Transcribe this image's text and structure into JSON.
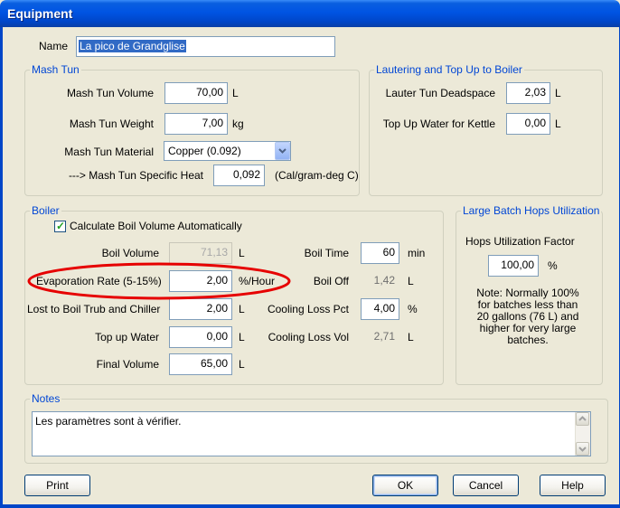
{
  "window": {
    "title": "Equipment",
    "close_label": "X"
  },
  "name": {
    "label": "Name",
    "value": "La pico de Grandglise"
  },
  "mash_tun": {
    "legend": "Mash Tun",
    "volume": {
      "label": "Mash Tun Volume",
      "value": "70,00",
      "unit": "L"
    },
    "weight": {
      "label": "Mash Tun Weight",
      "value": "7,00",
      "unit": "kg"
    },
    "material": {
      "label": "Mash Tun Material",
      "value": "Copper (0.092)"
    },
    "specific_heat": {
      "label": "---> Mash Tun Specific Heat",
      "value": "0,092",
      "unit": "(Cal/gram-deg C)"
    }
  },
  "lautering": {
    "legend": "Lautering and Top Up to Boiler",
    "deadspace": {
      "label": "Lauter Tun Deadspace",
      "value": "2,03",
      "unit": "L"
    },
    "top_up_kettle": {
      "label": "Top Up Water for Kettle",
      "value": "0,00",
      "unit": "L"
    }
  },
  "boiler": {
    "legend": "Boiler",
    "calc_checkbox": {
      "label": "Calculate Boil Volume Automatically",
      "checked": true
    },
    "boil_volume": {
      "label": "Boil Volume",
      "value": "71,13",
      "unit": "L"
    },
    "evaporation": {
      "label": "Evaporation Rate (5-15%)",
      "value": "2,00",
      "unit": "%/Hour"
    },
    "lost_trub": {
      "label": "Lost to Boil Trub and Chiller",
      "value": "2,00",
      "unit": "L"
    },
    "top_up_water": {
      "label": "Top up Water",
      "value": "0,00",
      "unit": "L"
    },
    "final_volume": {
      "label": "Final Volume",
      "value": "65,00",
      "unit": "L"
    },
    "boil_time": {
      "label": "Boil Time",
      "value": "60",
      "unit": "min"
    },
    "boil_off": {
      "label": "Boil Off",
      "value": "1,42",
      "unit": "L"
    },
    "cooling_loss_pct": {
      "label": "Cooling Loss Pct",
      "value": "4,00",
      "unit": "%"
    },
    "cooling_loss_vol": {
      "label": "Cooling Loss Vol",
      "value": "2,71",
      "unit": "L"
    }
  },
  "hops": {
    "legend": "Large Batch Hops Utilization",
    "factor_label": "Hops Utilization Factor",
    "factor_value": "100,00",
    "factor_unit": "%",
    "note_lines": [
      "Note: Normally 100%",
      "for batches less than",
      "20 gallons (76 L) and",
      "higher for very large",
      "batches."
    ]
  },
  "notes": {
    "legend": "Notes",
    "value": "Les paramètres sont à vérifier."
  },
  "buttons": {
    "print": "Print",
    "ok": "OK",
    "cancel": "Cancel",
    "help": "Help"
  },
  "colors": {
    "title_bar": "#0054e3",
    "dialog_bg": "#ece9d8",
    "group_legend": "#0046d5",
    "highlight_ellipse": "#e60000"
  }
}
